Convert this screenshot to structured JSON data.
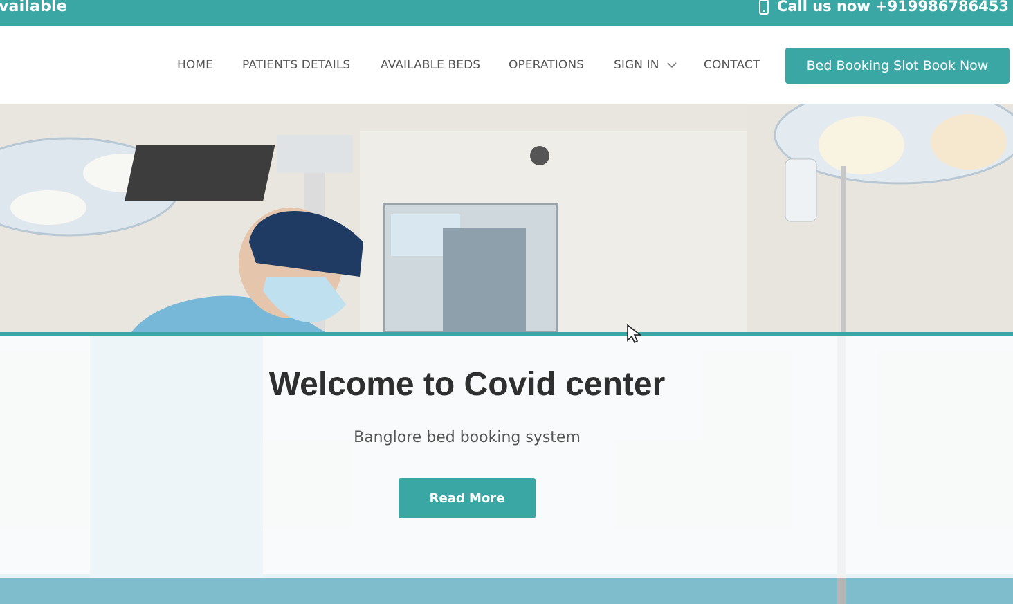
{
  "topbar": {
    "left_text": "vailable",
    "call_text": "Call us now +919986786453",
    "phone_icon": "phone-icon"
  },
  "nav": {
    "items": [
      {
        "label": "HOME"
      },
      {
        "label": "PATIENTS DETAILS"
      },
      {
        "label": "AVAILABLE BEDS"
      },
      {
        "label": "OPERATIONS"
      },
      {
        "label": "SIGN IN"
      },
      {
        "label": "CONTACT"
      }
    ],
    "cta_label": "Bed Booking Slot Book Now"
  },
  "hero": {
    "title": "Welcome to Covid center",
    "subtitle": "Banglore bed booking system",
    "button_label": "Read More"
  },
  "colors": {
    "accent": "#3aa7a4",
    "text_dark": "#2f2f2f",
    "nav_text": "#555555"
  }
}
